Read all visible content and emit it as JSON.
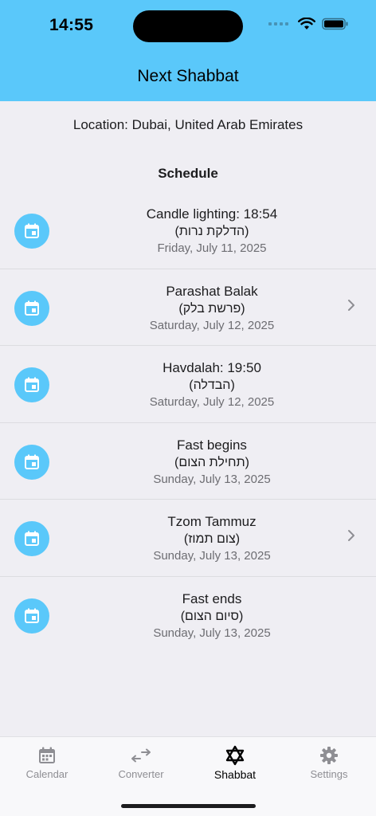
{
  "status_bar": {
    "time": "14:55"
  },
  "nav": {
    "title": "Next Shabbat"
  },
  "location": "Location: Dubai, United Arab Emirates",
  "schedule_title": "Schedule",
  "events": [
    {
      "title": "Candle lighting: 18:54",
      "hebrew": "(הדלקת נרות)",
      "date": "Friday, July 11, 2025",
      "has_detail": false
    },
    {
      "title": "Parashat Balak",
      "hebrew": "(פרשת בלק)",
      "date": "Saturday, July 12, 2025",
      "has_detail": true
    },
    {
      "title": "Havdalah: 19:50",
      "hebrew": "(הבדלה)",
      "date": "Saturday, July 12, 2025",
      "has_detail": false
    },
    {
      "title": "Fast begins",
      "hebrew": "(תחילת הצום)",
      "date": "Sunday, July 13, 2025",
      "has_detail": false
    },
    {
      "title": "Tzom Tammuz",
      "hebrew": "(צום תמוז)",
      "date": "Sunday, July 13, 2025",
      "has_detail": true
    },
    {
      "title": "Fast ends",
      "hebrew": "(סיום הצום)",
      "date": "Sunday, July 13, 2025",
      "has_detail": false
    }
  ],
  "tabs": [
    {
      "label": "Calendar",
      "icon": "calendar-icon",
      "active": false
    },
    {
      "label": "Converter",
      "icon": "converter-icon",
      "active": false
    },
    {
      "label": "Shabbat",
      "icon": "star-of-david-icon",
      "active": true
    },
    {
      "label": "Settings",
      "icon": "gear-icon",
      "active": false
    }
  ],
  "colors": {
    "accent": "#5ac8fa",
    "background": "#efeef3",
    "secondary_text": "#6d6d72",
    "inactive_tab": "#8e8e93"
  }
}
